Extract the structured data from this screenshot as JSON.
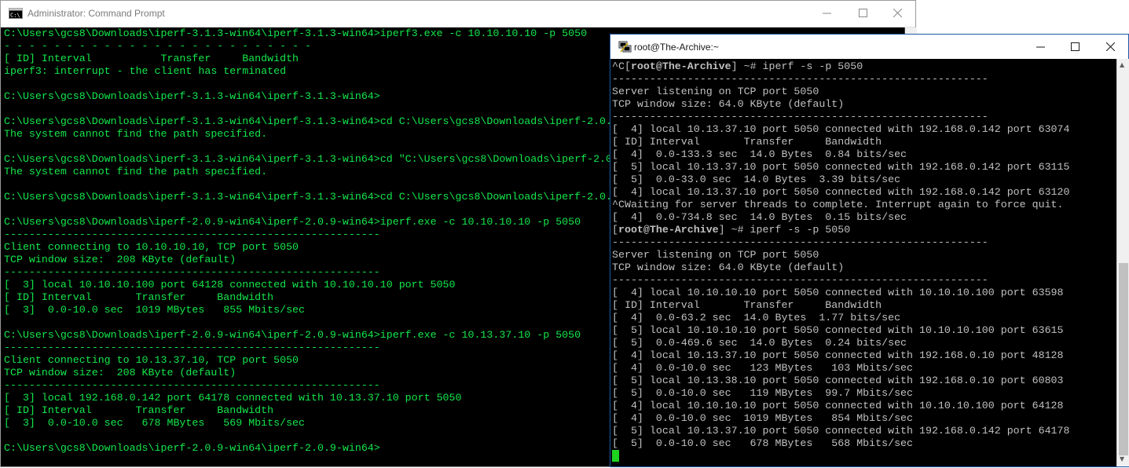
{
  "cmd_window": {
    "title": "Administrator: Command Prompt",
    "icon": "cmd-icon",
    "text_color": "#13e84b",
    "lines": [
      "C:\\Users\\gcs8\\Downloads\\iperf-3.1.3-win64\\iperf-3.1.3-win64>iperf3.exe -c 10.10.10.10 -p 5050",
      "- - - - - - - - - - - - - - - - - - - - - - - - -",
      "[ ID] Interval           Transfer     Bandwidth",
      "iperf3: interrupt - the client has terminated",
      "",
      "C:\\Users\\gcs8\\Downloads\\iperf-3.1.3-win64\\iperf-3.1.3-win64>",
      "",
      "C:\\Users\\gcs8\\Downloads\\iperf-3.1.3-win64\\iperf-3.1.3-win64>cd C:\\Users\\gcs8\\Downloads\\iperf-2.0.",
      "The system cannot find the path specified.",
      "",
      "C:\\Users\\gcs8\\Downloads\\iperf-3.1.3-win64\\iperf-3.1.3-win64>cd \"C:\\Users\\gcs8\\Downloads\\iperf-2.0",
      "The system cannot find the path specified.",
      "",
      "C:\\Users\\gcs8\\Downloads\\iperf-3.1.3-win64\\iperf-3.1.3-win64>cd C:\\Users\\gcs8\\Downloads\\iperf-2.0.",
      "",
      "C:\\Users\\gcs8\\Downloads\\iperf-2.0.9-win64\\iperf-2.0.9-win64>iperf.exe -c 10.10.10.10 -p 5050",
      "------------------------------------------------------------",
      "Client connecting to 10.10.10.10, TCP port 5050",
      "TCP window size:  208 KByte (default)",
      "------------------------------------------------------------",
      "[  3] local 10.10.10.100 port 64128 connected with 10.10.10.10 port 5050",
      "[ ID] Interval       Transfer     Bandwidth",
      "[  3]  0.0-10.0 sec  1019 MBytes   855 Mbits/sec",
      "",
      "C:\\Users\\gcs8\\Downloads\\iperf-2.0.9-win64\\iperf-2.0.9-win64>iperf.exe -c 10.13.37.10 -p 5050",
      "------------------------------------------------------------",
      "Client connecting to 10.13.37.10, TCP port 5050",
      "TCP window size:  208 KByte (default)",
      "------------------------------------------------------------",
      "[  3] local 192.168.0.142 port 64178 connected with 10.13.37.10 port 5050",
      "[ ID] Interval       Transfer     Bandwidth",
      "[  3]  0.0-10.0 sec   678 MBytes   569 Mbits/sec",
      "",
      "C:\\Users\\gcs8\\Downloads\\iperf-2.0.9-win64\\iperf-2.0.9-win64>"
    ]
  },
  "putty_window": {
    "title": "root@The-Archive:~",
    "icon": "putty-icon",
    "text_color": "#c0c0c0",
    "cursor_color": "#1ed41e",
    "lines": [
      {
        "pre": "^C[",
        "bold": "root@The-Archive",
        "post": "] ~# iperf -s -p 5050"
      },
      {
        "text": "------------------------------------------------------------"
      },
      {
        "text": "Server listening on TCP port 5050"
      },
      {
        "text": "TCP window size: 64.0 KByte (default)"
      },
      {
        "text": "------------------------------------------------------------"
      },
      {
        "text": "[  4] local 10.13.37.10 port 5050 connected with 192.168.0.142 port 63074"
      },
      {
        "text": "[ ID] Interval       Transfer     Bandwidth"
      },
      {
        "text": "[  4]  0.0-133.3 sec  14.0 Bytes  0.84 bits/sec"
      },
      {
        "text": "[  5] local 10.13.37.10 port 5050 connected with 192.168.0.142 port 63115"
      },
      {
        "text": "[  5]  0.0-33.0 sec  14.0 Bytes  3.39 bits/sec"
      },
      {
        "text": "[  4] local 10.13.37.10 port 5050 connected with 192.168.0.142 port 63120"
      },
      {
        "text": "^CWaiting for server threads to complete. Interrupt again to force quit."
      },
      {
        "text": "[  4]  0.0-734.8 sec  14.0 Bytes  0.15 bits/sec"
      },
      {
        "pre": "[",
        "bold": "root@The-Archive",
        "post": "] ~# iperf -s -p 5050"
      },
      {
        "text": "------------------------------------------------------------"
      },
      {
        "text": "Server listening on TCP port 5050"
      },
      {
        "text": "TCP window size: 64.0 KByte (default)"
      },
      {
        "text": "------------------------------------------------------------"
      },
      {
        "text": "[  4] local 10.10.10.10 port 5050 connected with 10.10.10.100 port 63598"
      },
      {
        "text": "[ ID] Interval       Transfer     Bandwidth"
      },
      {
        "text": "[  4]  0.0-63.2 sec  14.0 Bytes  1.77 bits/sec"
      },
      {
        "text": "[  5] local 10.10.10.10 port 5050 connected with 10.10.10.100 port 63615"
      },
      {
        "text": "[  5]  0.0-469.6 sec  14.0 Bytes  0.24 bits/sec"
      },
      {
        "text": "[  4] local 10.13.37.10 port 5050 connected with 192.168.0.10 port 48128"
      },
      {
        "text": "[  4]  0.0-10.0 sec   123 MBytes   103 Mbits/sec"
      },
      {
        "text": "[  5] local 10.13.38.10 port 5050 connected with 192.168.0.10 port 60803"
      },
      {
        "text": "[  5]  0.0-10.0 sec   119 MBytes  99.7 Mbits/sec"
      },
      {
        "text": "[  4] local 10.10.10.10 port 5050 connected with 10.10.10.100 port 64128"
      },
      {
        "text": "[  4]  0.0-10.0 sec  1019 MBytes   854 Mbits/sec"
      },
      {
        "text": "[  5] local 10.13.37.10 port 5050 connected with 192.168.0.142 port 64178"
      },
      {
        "text": "[  5]  0.0-10.0 sec   678 MBytes   568 Mbits/sec"
      }
    ]
  }
}
